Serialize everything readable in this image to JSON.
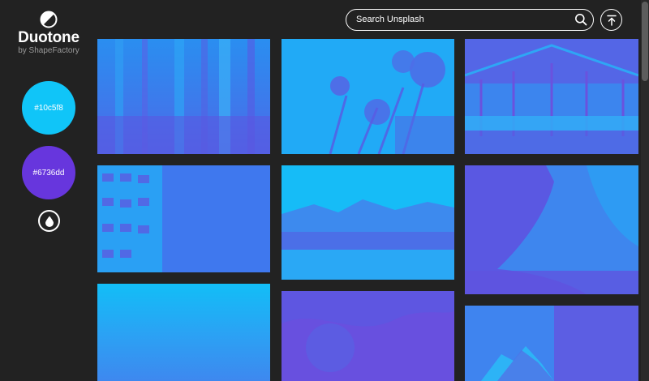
{
  "app": {
    "title": "Duotone",
    "byline": "by ShapeFactory",
    "logo_icon": "half-circle-logo-icon"
  },
  "colors": {
    "light": "#10c5f8",
    "dark": "#6736dd",
    "background": "#222222"
  },
  "swatches": [
    {
      "label": "#10c5f8",
      "color": "#10c5f8"
    },
    {
      "label": "#6736dd",
      "color": "#6736dd"
    }
  ],
  "controls": {
    "drop_icon": "water-drop-icon",
    "top_icon": "arrow-up-to-top-icon"
  },
  "search": {
    "placeholder": "Search Unsplash",
    "value": "",
    "icon": "search-icon"
  },
  "photos": [
    {
      "subject": "forest"
    },
    {
      "subject": "flowers"
    },
    {
      "subject": "greenhouse"
    },
    {
      "subject": "building-facade"
    },
    {
      "subject": "mountain-lake"
    },
    {
      "subject": "canyon-rock"
    },
    {
      "subject": "hazy-sky"
    },
    {
      "subject": "abstract"
    },
    {
      "subject": "snowy-peak"
    }
  ]
}
